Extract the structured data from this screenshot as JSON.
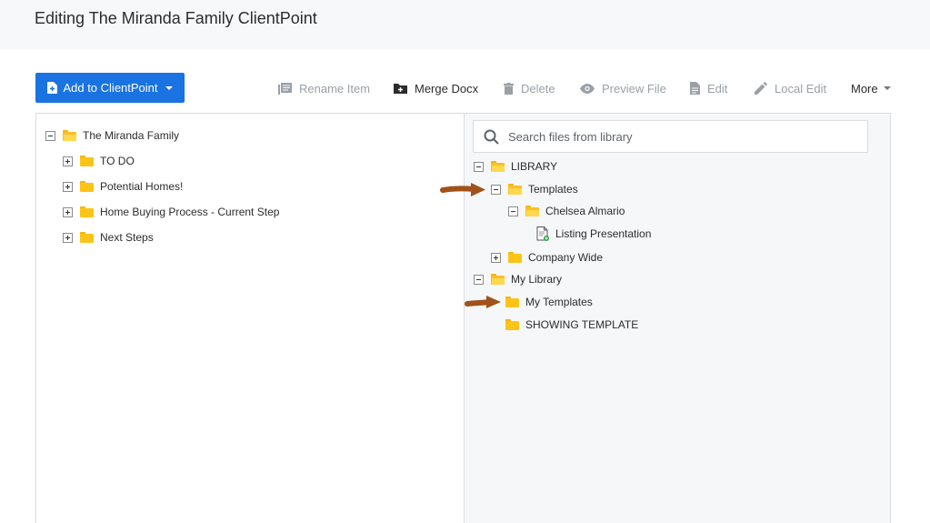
{
  "header": {
    "title": "Editing The Miranda Family ClientPoint"
  },
  "add_button": {
    "label": "Add to ClientPoint"
  },
  "toolbar": {
    "rename": "Rename Item",
    "merge": "Merge Docx",
    "delete": "Delete",
    "preview": "Preview File",
    "edit": "Edit",
    "local_edit": "Local Edit",
    "more": "More"
  },
  "left_tree": {
    "root": "The Miranda Family",
    "items": [
      "TO DO",
      "Potential Homes!",
      "Home Buying Process - Current Step",
      "Next Steps"
    ]
  },
  "search": {
    "placeholder": "Search files from library"
  },
  "right_tree": {
    "library": "LIBRARY",
    "templates": "Templates",
    "chelsea": "Chelsea Almario",
    "listing": "Listing Presentation",
    "company_wide": "Company Wide",
    "my_library": "My Library",
    "my_templates": "My Templates",
    "showing_template": "SHOWING TEMPLATE"
  },
  "colors": {
    "accent": "#1a73e0",
    "folder": "#fcc419",
    "arrow": "#a0521a"
  }
}
